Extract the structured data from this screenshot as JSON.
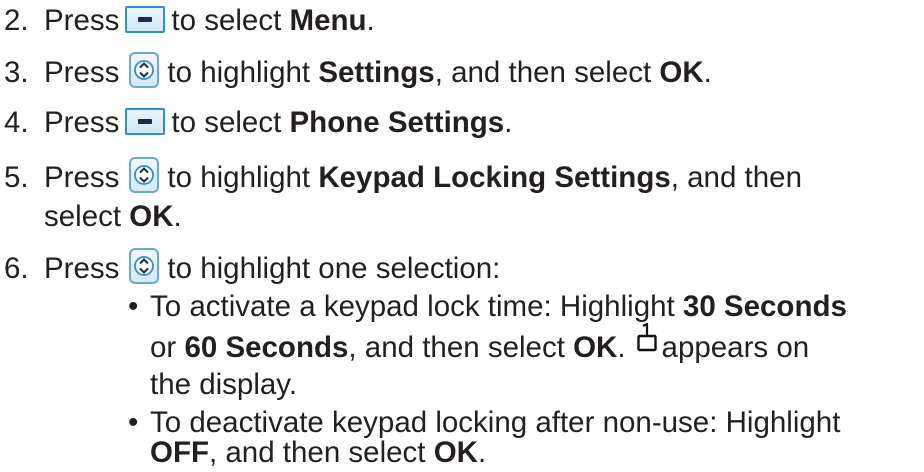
{
  "steps": {
    "s2": {
      "num": "2.",
      "press": "Press",
      "after": "to select",
      "bold1": "Menu",
      "end": "."
    },
    "s3": {
      "num": "3.",
      "press": "Press",
      "after": "to highlight",
      "bold1": "Settings",
      "mid": ", and then select",
      "bold2": "OK",
      "end": "."
    },
    "s4": {
      "num": "4.",
      "press": "Press",
      "after": "to select",
      "bold1": "Phone Settings",
      "end": "."
    },
    "s5": {
      "num": "5.",
      "press": "Press",
      "after": "to highlight",
      "bold1": "Keypad Locking Settings",
      "mid": ", and then",
      "line2a": "select",
      "bold2": "OK",
      "end": "."
    },
    "s6": {
      "num": "6.",
      "press": "Press",
      "after": "to highlight one selection:"
    }
  },
  "bullets": {
    "b1": {
      "dot": "•",
      "line1": "To activate a keypad lock time: Highlight",
      "bold1": "30 Seconds",
      "line2a": "or",
      "bold2": "60 Seconds",
      "line2b": ", and then select",
      "bold3": "OK",
      "line2c": ".",
      "line2d": "appears on",
      "line3": "the display."
    },
    "b2": {
      "dot": "•",
      "line1": "To deactivate keypad locking after non-use: Highlight",
      "bold1": "OFF",
      "line2a": ", and then select",
      "bold2": "OK",
      "line2b": "."
    }
  },
  "icons": {
    "softkey": "minus-softkey-icon",
    "navkey": "up-down-navigation-key-icon",
    "lock": "keypad-lock-icon"
  },
  "colors": {
    "text": "#231f20",
    "key_border": "#2f8fd0",
    "nav_border": "#6aa6d6"
  }
}
